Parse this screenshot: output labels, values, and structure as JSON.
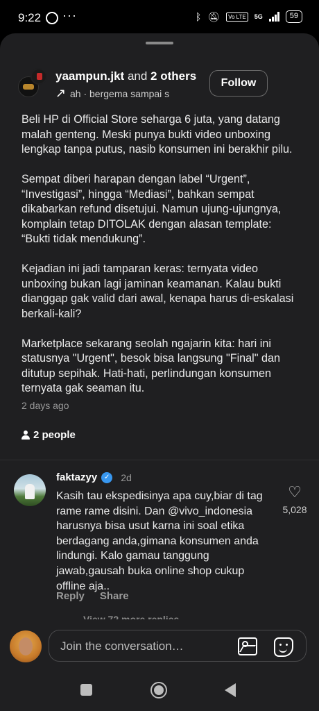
{
  "status_bar": {
    "time": "9:22",
    "dots": "···",
    "lte": "Vo LTE",
    "network": "5G",
    "battery": "59"
  },
  "post": {
    "author": "yaampun.jkt",
    "and_text": "and",
    "others": "2 others",
    "subtitle_prefix": "ah",
    "subtitle_separator": "·",
    "subtitle_text": "bergema sampai s",
    "follow_label": "Follow",
    "paragraphs": [
      "Beli HP di Official Store seharga 6 juta, yang datang malah genteng. Meski punya bukti video unboxing lengkap tanpa putus, nasib konsumen ini berakhir pilu.",
      "Sempat diberi harapan dengan label “Urgent”, “Investigasi”, hingga “Mediasi”, bahkan sempat dikabarkan refund disetujui. Namun ujung-ujungnya, komplain tetap DITOLAK dengan alasan template: “Bukti tidak mendukung”.",
      "Kejadian ini jadi tamparan keras: ternyata video unboxing bukan lagi jaminan keamanan. Kalau bukti dianggap gak valid dari awal, kenapa harus di-eskalasi berkali-kali?",
      "Marketplace sekarang seolah ngajarin kita: hari ini statusnya \"Urgent\", besok bisa langsung \"Final\" dan ditutup sepihak. Hati-hati, perlindungan konsumen ternyata gak seaman itu."
    ],
    "timestamp": "2 days ago",
    "people": "2 people"
  },
  "comment": {
    "username": "faktazyy",
    "time": "2d",
    "text_before_mention": "Kasih tau ekspedisinya apa cuy,biar di tag rame rame disini. Dan ",
    "mention": "@vivo_indonesia",
    "text_after_mention": " harusnya bisa usut karna ini soal etika berdagang anda,gimana konsumen anda lindungi. Kalo gamau tanggung jawab,gausah buka online shop cukup offline aja..",
    "likes": "5,028",
    "reply_label": "Reply",
    "share_label": "Share",
    "more_replies": "View 72 more replies"
  },
  "composer": {
    "placeholder": "Join the conversation…"
  },
  "colors": {
    "background": "#000000",
    "sheet": "#1f1f21",
    "text": "#eaeaea",
    "muted": "#9a9a9a",
    "verified": "#3897f0"
  },
  "icons": [
    "whatsapp-icon",
    "bluetooth-icon",
    "mute-icon",
    "signal-icon",
    "battery-icon",
    "arrow-icon",
    "person-icon",
    "verified-icon",
    "heart-icon",
    "image-icon",
    "sticker-icon",
    "nav-recents-icon",
    "nav-home-icon",
    "nav-back-icon"
  ]
}
